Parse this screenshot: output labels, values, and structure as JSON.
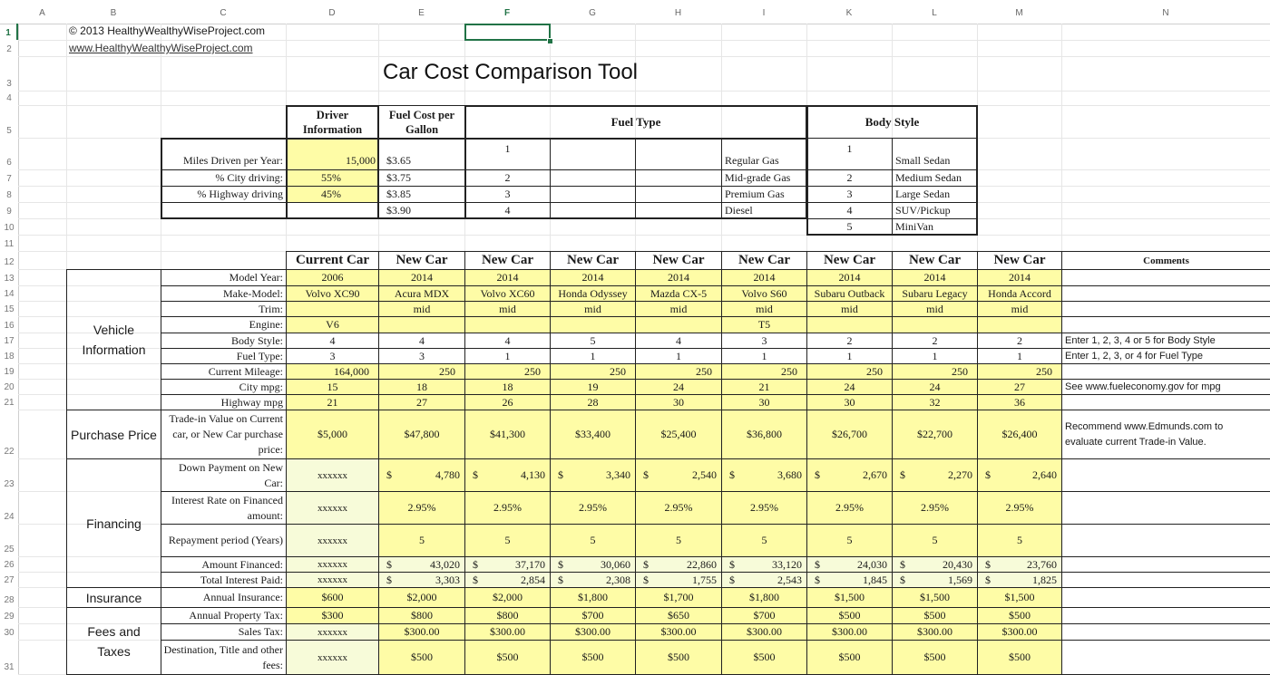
{
  "columns": [
    "A",
    "B",
    "C",
    "D",
    "E",
    "F",
    "G",
    "H",
    "I",
    "K",
    "L",
    "M",
    "N"
  ],
  "active_column": "F",
  "active_row": "1",
  "rows": [
    "1",
    "2",
    "3",
    "4",
    "5",
    "6",
    "7",
    "8",
    "9",
    "10",
    "11",
    "12",
    "13",
    "14",
    "15",
    "16",
    "17",
    "18",
    "19",
    "20",
    "21",
    "22",
    "23",
    "24",
    "25",
    "26",
    "27",
    "28",
    "29",
    "30",
    "31"
  ],
  "copyright": "© 2013 HealthyWealthyWiseProject.com",
  "website_link": "www.HealthyWealthyWiseProject.com",
  "title": "Car Cost Comparison Tool",
  "driver": {
    "header": "Driver Information",
    "fuel_cost_header": "Fuel Cost per Gallon",
    "labels": [
      "Miles Driven per Year:",
      "% City driving:",
      "% Highway driving"
    ],
    "values": [
      "15,000",
      "55%",
      "45%"
    ],
    "fuel_costs": [
      "$3.65",
      "$3.75",
      "$3.85",
      "$3.90"
    ]
  },
  "fuel_type": {
    "header": "Fuel Type",
    "codes": [
      "1",
      "2",
      "3",
      "4"
    ],
    "names": [
      "Regular Gas",
      "Mid-grade Gas",
      "Premium Gas",
      "Diesel"
    ]
  },
  "body_style": {
    "header": "Body Style",
    "codes": [
      "1",
      "2",
      "3",
      "4",
      "5"
    ],
    "names": [
      "Small Sedan",
      "Medium Sedan",
      "Large Sedan",
      "SUV/Pickup",
      "MiniVan"
    ]
  },
  "comparison": {
    "car_headers": [
      "Current Car",
      "New Car",
      "New Car",
      "New Car",
      "New Car",
      "New Car",
      "New Car",
      "New Car",
      "New Car"
    ],
    "comments_header": "Comments",
    "sections": {
      "vehicle": "Vehicle Information",
      "purchase": "Purchase Price",
      "financing": "Financing",
      "insurance": "Insurance",
      "fees": "Fees and Taxes"
    },
    "rows": {
      "model_year": {
        "label": "Model Year:",
        "values": [
          "2006",
          "2014",
          "2014",
          "2014",
          "2014",
          "2014",
          "2014",
          "2014",
          "2014"
        ],
        "comment": ""
      },
      "make_model": {
        "label": "Make-Model:",
        "values": [
          "Volvo XC90",
          "Acura MDX",
          "Volvo XC60",
          "Honda Odyssey",
          "Mazda CX-5",
          "Volvo S60",
          "Subaru Outback",
          "Subaru Legacy",
          "Honda Accord"
        ],
        "comment": ""
      },
      "trim": {
        "label": "Trim:",
        "values": [
          "",
          "mid",
          "mid",
          "mid",
          "mid",
          "mid",
          "mid",
          "mid",
          "mid"
        ],
        "comment": ""
      },
      "engine": {
        "label": "Engine:",
        "values": [
          "V6",
          "",
          "",
          "",
          "",
          "T5",
          "",
          "",
          ""
        ],
        "comment": ""
      },
      "body_style": {
        "label": "Body Style:",
        "values": [
          "4",
          "4",
          "4",
          "5",
          "4",
          "3",
          "2",
          "2",
          "2"
        ],
        "comment": "Enter 1, 2, 3, 4 or 5 for Body Style"
      },
      "fuel_type": {
        "label": "Fuel Type:",
        "values": [
          "3",
          "3",
          "1",
          "1",
          "1",
          "1",
          "1",
          "1",
          "1"
        ],
        "comment": "Enter 1, 2, 3, or 4 for Fuel Type"
      },
      "current_mileage": {
        "label": "Current Mileage:",
        "values": [
          "164,000",
          "250",
          "250",
          "250",
          "250",
          "250",
          "250",
          "250",
          "250"
        ],
        "comment": ""
      },
      "city_mpg": {
        "label": "City mpg:",
        "values": [
          "15",
          "18",
          "18",
          "19",
          "24",
          "21",
          "24",
          "24",
          "27"
        ],
        "comment": "See www.fueleconomy.gov for mpg"
      },
      "highway_mpg": {
        "label": "Highway mpg",
        "values": [
          "21",
          "27",
          "26",
          "28",
          "30",
          "30",
          "30",
          "32",
          "36"
        ],
        "comment": ""
      },
      "purchase_price": {
        "label": "Trade-in Value on Current car, or New Car purchase price:",
        "values": [
          "$5,000",
          "$47,800",
          "$41,300",
          "$33,400",
          "$25,400",
          "$36,800",
          "$26,700",
          "$22,700",
          "$26,400"
        ],
        "comment": "Recommend www.Edmunds.com to evaluate current Trade-in Value."
      },
      "down_payment": {
        "label": "Down Payment on New Car:",
        "values": [
          "xxxxxx",
          "4,780",
          "4,130",
          "3,340",
          "2,540",
          "3,680",
          "2,670",
          "2,270",
          "2,640"
        ],
        "comment": ""
      },
      "interest_rate": {
        "label": "Interest Rate on Financed amount:",
        "values": [
          "xxxxxx",
          "2.95%",
          "2.95%",
          "2.95%",
          "2.95%",
          "2.95%",
          "2.95%",
          "2.95%",
          "2.95%"
        ],
        "comment": ""
      },
      "repayment": {
        "label": "Repayment period (Years)",
        "values": [
          "xxxxxx",
          "5",
          "5",
          "5",
          "5",
          "5",
          "5",
          "5",
          "5"
        ],
        "comment": ""
      },
      "amount_financed": {
        "label": "Amount Financed:",
        "values": [
          "xxxxxx",
          "43,020",
          "37,170",
          "30,060",
          "22,860",
          "33,120",
          "24,030",
          "20,430",
          "23,760"
        ],
        "comment": ""
      },
      "total_interest": {
        "label": "Total Interest Paid:",
        "values": [
          "xxxxxx",
          "3,303",
          "2,854",
          "2,308",
          "1,755",
          "2,543",
          "1,845",
          "1,569",
          "1,825"
        ],
        "comment": ""
      },
      "annual_insurance": {
        "label": "Annual Insurance:",
        "values": [
          "$600",
          "$2,000",
          "$2,000",
          "$1,800",
          "$1,700",
          "$1,800",
          "$1,500",
          "$1,500",
          "$1,500"
        ],
        "comment": ""
      },
      "property_tax": {
        "label": "Annual Property Tax:",
        "values": [
          "$300",
          "$800",
          "$800",
          "$700",
          "$650",
          "$700",
          "$500",
          "$500",
          "$500"
        ],
        "comment": ""
      },
      "sales_tax": {
        "label": "Sales Tax:",
        "values": [
          "xxxxxx",
          "$300.00",
          "$300.00",
          "$300.00",
          "$300.00",
          "$300.00",
          "$300.00",
          "$300.00",
          "$300.00"
        ],
        "comment": ""
      },
      "dest_fees": {
        "label": "Destination, Title and other fees:",
        "values": [
          "xxxxxx",
          "$500",
          "$500",
          "$500",
          "$500",
          "$500",
          "$500",
          "$500",
          "$500"
        ],
        "comment": ""
      }
    },
    "currency_symbol": "$"
  },
  "colors": {
    "input_yellow": "#fefca6",
    "light_green": "#f7fbd9",
    "selection_green": "#217346"
  }
}
